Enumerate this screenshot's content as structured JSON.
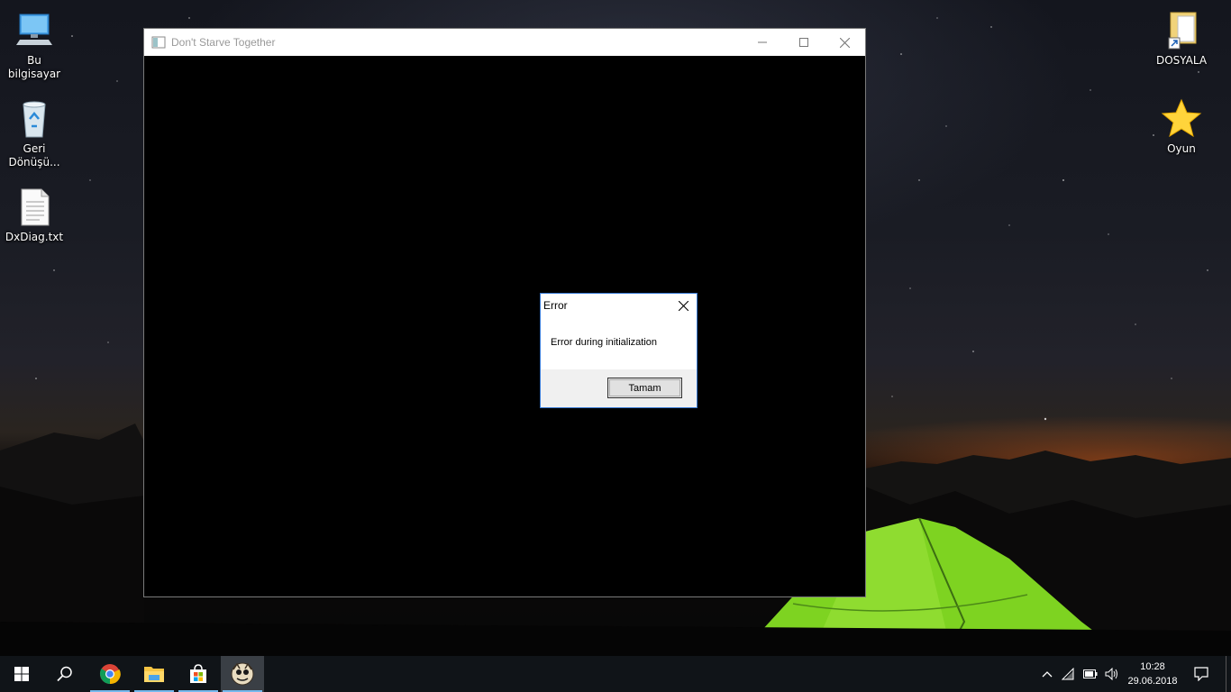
{
  "desktop": {
    "icons_left": [
      {
        "label": "Bu bilgisayar",
        "icon": "this-pc-icon"
      },
      {
        "label": "Geri Dönüşü...",
        "icon": "recycle-bin-icon"
      },
      {
        "label": "DxDiag.txt",
        "icon": "text-file-icon"
      }
    ],
    "icons_right": [
      {
        "label": "DOSYALA",
        "icon": "folder-shortcut-icon"
      },
      {
        "label": "Oyun",
        "icon": "star-icon"
      }
    ]
  },
  "game_window": {
    "title": "Don't Starve Together",
    "controls": [
      "minimize",
      "maximize",
      "close"
    ]
  },
  "error_dialog": {
    "title": "Error",
    "message": "Error during initialization",
    "ok_label": "Tamam"
  },
  "taskbar": {
    "pinned": [
      {
        "name": "start",
        "icon": "windows-logo-icon"
      },
      {
        "name": "search",
        "icon": "search-icon"
      },
      {
        "name": "chrome",
        "icon": "chrome-icon"
      },
      {
        "name": "file-explorer",
        "icon": "folder-icon"
      },
      {
        "name": "store",
        "icon": "store-icon"
      },
      {
        "name": "dont-starve-together",
        "icon": "dst-icon"
      }
    ],
    "tray": [
      "chevron-up-icon",
      "wifi-icon",
      "battery-icon",
      "volume-icon"
    ],
    "clock": {
      "time": "10:28",
      "date": "29.06.2018"
    }
  },
  "colors": {
    "taskbar_bg": "#101418",
    "running_indicator": "#76b9ed",
    "dialog_border": "#3a7bd5",
    "tent_green": "#7ed321"
  }
}
